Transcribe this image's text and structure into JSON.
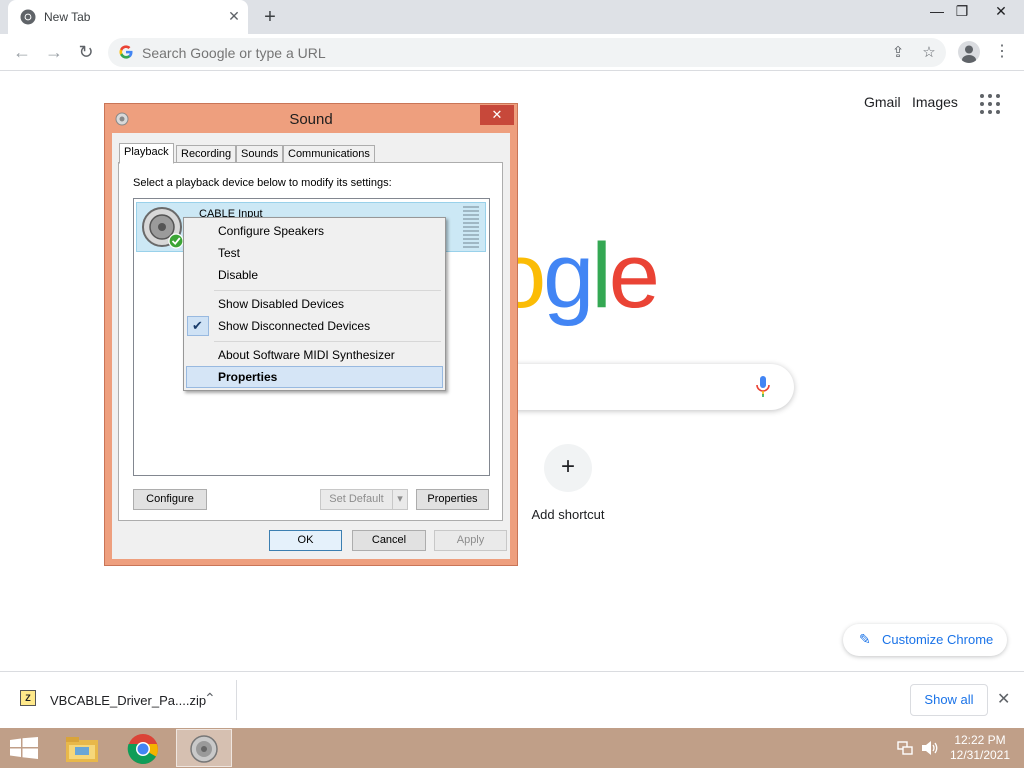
{
  "browser": {
    "tab_title": "New Tab",
    "tab_close": "✕",
    "new_tab": "+",
    "window_controls": {
      "minimize": "—",
      "restore": "❐",
      "close": "✕"
    },
    "omnibox_placeholder": "Search Google or type a URL",
    "nav": {
      "back": "←",
      "forward": "→",
      "reload": "↻"
    },
    "omni_icons": {
      "share": "⇪",
      "bookmark": "☆"
    },
    "menu": "⋮"
  },
  "ntp": {
    "gmail": "Gmail",
    "images": "Images",
    "logo_letters": [
      {
        "ch": "o",
        "color": "#fbbc05"
      },
      {
        "ch": "g",
        "color": "#4285f4"
      },
      {
        "ch": "l",
        "color": "#34a853"
      },
      {
        "ch": "e",
        "color": "#ea4335"
      }
    ],
    "add_shortcut_icon": "+",
    "add_shortcut": "Add shortcut",
    "customize_icon": "✎",
    "customize": "Customize Chrome"
  },
  "download_bar": {
    "file_icon": "Z",
    "file_name": "VBCABLE_Driver_Pa....zip",
    "chevron": "⌃",
    "show_all": "Show all",
    "close": "✕"
  },
  "taskbar": {
    "time": "12:22 PM",
    "date": "12/31/2021"
  },
  "sound_dialog": {
    "title": "Sound",
    "close": "✕",
    "tabs": [
      "Playback",
      "Recording",
      "Sounds",
      "Communications"
    ],
    "instruction": "Select a playback device below to modify its settings:",
    "device_name": "CABLE Input",
    "buttons": {
      "configure": "Configure",
      "set_default": "Set Default",
      "set_default_arrow": "▾",
      "properties": "Properties",
      "ok": "OK",
      "cancel": "Cancel",
      "apply": "Apply"
    }
  },
  "context_menu": {
    "items": [
      "Configure Speakers",
      "Test",
      "Disable",
      "Show Disabled Devices",
      "Show Disconnected Devices",
      "About Software MIDI Synthesizer",
      "Properties"
    ],
    "checkmark": "✔",
    "checked_item": "Show Disconnected Devices",
    "highlighted_item": "Properties"
  }
}
